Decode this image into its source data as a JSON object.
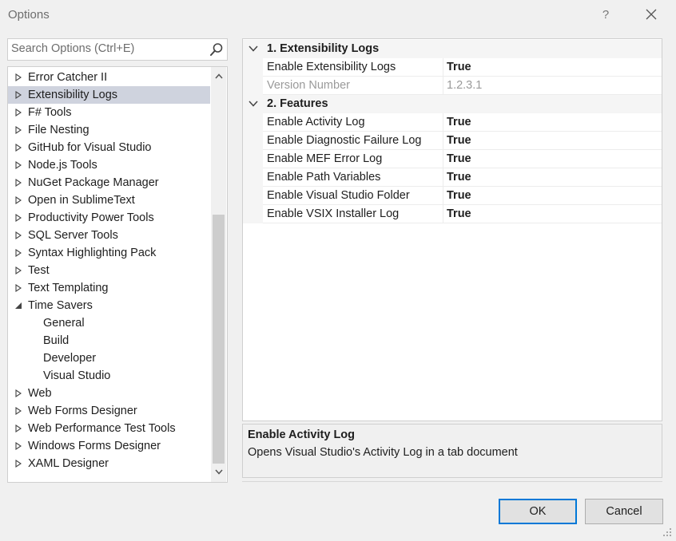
{
  "window": {
    "title": "Options",
    "help_label": "?",
    "close_icon": "close-icon"
  },
  "search": {
    "placeholder": "Search Options (Ctrl+E)",
    "value": "",
    "icon": "search-icon"
  },
  "tree": {
    "items": [
      {
        "label": "Error Catcher II",
        "expanded": false,
        "selected": false
      },
      {
        "label": "Extensibility Logs",
        "expanded": false,
        "selected": true
      },
      {
        "label": "F# Tools",
        "expanded": false,
        "selected": false
      },
      {
        "label": "File Nesting",
        "expanded": false,
        "selected": false
      },
      {
        "label": "GitHub for Visual Studio",
        "expanded": false,
        "selected": false
      },
      {
        "label": "Node.js Tools",
        "expanded": false,
        "selected": false
      },
      {
        "label": "NuGet Package Manager",
        "expanded": false,
        "selected": false
      },
      {
        "label": "Open in SublimeText",
        "expanded": false,
        "selected": false
      },
      {
        "label": "Productivity Power Tools",
        "expanded": false,
        "selected": false
      },
      {
        "label": "SQL Server Tools",
        "expanded": false,
        "selected": false
      },
      {
        "label": "Syntax Highlighting Pack",
        "expanded": false,
        "selected": false
      },
      {
        "label": "Test",
        "expanded": false,
        "selected": false
      },
      {
        "label": "Text Templating",
        "expanded": false,
        "selected": false
      },
      {
        "label": "Time Savers",
        "expanded": true,
        "selected": false
      },
      {
        "label": "General",
        "child": true
      },
      {
        "label": "Build",
        "child": true
      },
      {
        "label": "Developer",
        "child": true
      },
      {
        "label": "Visual Studio",
        "child": true
      },
      {
        "label": "Web",
        "expanded": false,
        "selected": false
      },
      {
        "label": "Web Forms Designer",
        "expanded": false,
        "selected": false
      },
      {
        "label": "Web Performance Test Tools",
        "expanded": false,
        "selected": false
      },
      {
        "label": "Windows Forms Designer",
        "expanded": false,
        "selected": false
      },
      {
        "label": "XAML Designer",
        "expanded": false,
        "selected": false
      }
    ]
  },
  "property_grid": {
    "categories": [
      {
        "label": "1. Extensibility Logs",
        "properties": [
          {
            "name": "Enable Extensibility Logs",
            "value": "True",
            "readonly": false
          },
          {
            "name": "Version Number",
            "value": "1.2.3.1",
            "readonly": true
          }
        ]
      },
      {
        "label": "2. Features",
        "properties": [
          {
            "name": "Enable Activity Log",
            "value": "True",
            "readonly": false
          },
          {
            "name": "Enable Diagnostic Failure Log",
            "value": "True",
            "readonly": false
          },
          {
            "name": "Enable MEF Error Log",
            "value": "True",
            "readonly": false
          },
          {
            "name": "Enable Path Variables",
            "value": "True",
            "readonly": false
          },
          {
            "name": "Enable Visual Studio Folder",
            "value": "True",
            "readonly": false
          },
          {
            "name": "Enable VSIX Installer Log",
            "value": "True",
            "readonly": false
          }
        ]
      }
    ]
  },
  "description": {
    "title": "Enable Activity Log",
    "text": "Opens Visual Studio's Activity Log in a tab document"
  },
  "buttons": {
    "ok_label": "OK",
    "cancel_label": "Cancel"
  },
  "colors": {
    "selection": "#cfd3de",
    "accent": "#0078d7"
  }
}
